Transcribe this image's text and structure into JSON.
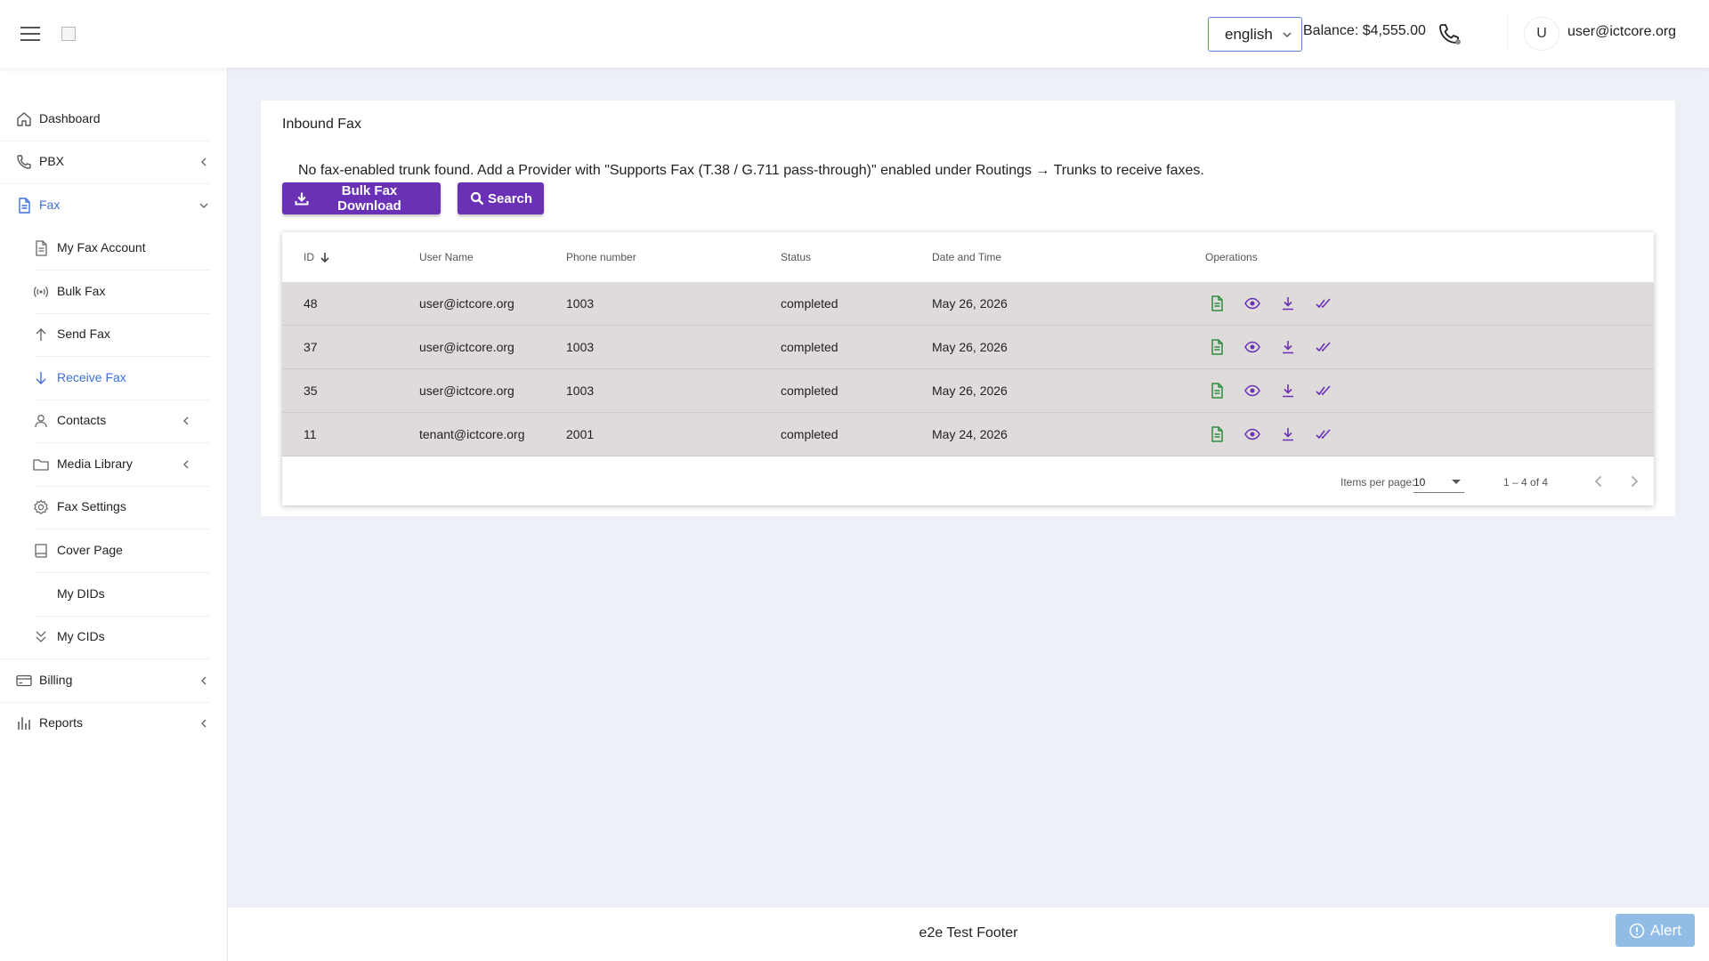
{
  "header": {
    "language": "english",
    "balance": "Balance: $4,555.00",
    "avatar_initial": "U",
    "user_email": "user@ictcore.org"
  },
  "sidebar": {
    "items": [
      {
        "label": "Dashboard",
        "icon": "home-icon"
      },
      {
        "label": "PBX",
        "icon": "phone-icon"
      },
      {
        "label": "Fax",
        "icon": "document-icon"
      },
      {
        "label": "Billing",
        "icon": "credit-card-icon"
      },
      {
        "label": "Reports",
        "icon": "bar-chart-icon"
      }
    ],
    "fax_subitems": [
      {
        "label": "My Fax Account",
        "icon": "document-icon"
      },
      {
        "label": "Bulk Fax",
        "icon": "broadcast-icon"
      },
      {
        "label": "Send Fax",
        "icon": "arrow-up-icon"
      },
      {
        "label": "Receive Fax",
        "icon": "arrow-down-icon"
      },
      {
        "label": "Contacts",
        "icon": "person-icon"
      },
      {
        "label": "Media Library",
        "icon": "folder-icon"
      },
      {
        "label": "Fax Settings",
        "icon": "gear-icon"
      },
      {
        "label": "Cover Page",
        "icon": "book-icon"
      },
      {
        "label": "My DIDs",
        "icon": ""
      },
      {
        "label": "My CIDs",
        "icon": "double-chevron-down-icon"
      }
    ]
  },
  "main": {
    "title": "Inbound Fax",
    "notice": "No fax-enabled trunk found. Add a Provider with \"Supports Fax (T.38 / G.711 pass-through)\" enabled under Routings → Trunks to receive faxes.",
    "bulk_download_label": "Bulk Fax Download",
    "search_label": "Search",
    "table": {
      "headers": {
        "id": "ID",
        "user_name": "User Name",
        "phone_number": "Phone number",
        "status": "Status",
        "date_time": "Date and Time",
        "operations": "Operations"
      },
      "rows": [
        {
          "id": "48",
          "user_name": "user@ictcore.org",
          "phone_number": "1003",
          "status": "completed",
          "date_time": "May 26, 2026"
        },
        {
          "id": "37",
          "user_name": "user@ictcore.org",
          "phone_number": "1003",
          "status": "completed",
          "date_time": "May 26, 2026"
        },
        {
          "id": "35",
          "user_name": "user@ictcore.org",
          "phone_number": "1003",
          "status": "completed",
          "date_time": "May 26, 2026"
        },
        {
          "id": "11",
          "user_name": "tenant@ictcore.org",
          "phone_number": "2001",
          "status": "completed",
          "date_time": "May 24, 2026"
        }
      ],
      "operations_icons": [
        "pdf-document-icon",
        "eye-icon",
        "download-icon",
        "double-check-icon"
      ]
    },
    "pager": {
      "items_per_page_label": "Items per page:",
      "items_per_page_value": "10",
      "range": "1 – 4 of 4"
    }
  },
  "footer": {
    "text": "e2e Test Footer",
    "alert_label": "Alert"
  },
  "colors": {
    "accent_purple": "#6a31b6",
    "active_blue": "#3d6fd9",
    "row_bg": "#dfdbdb",
    "green_icon": "#2e8b3e",
    "alert_bg": "#90bce6"
  }
}
